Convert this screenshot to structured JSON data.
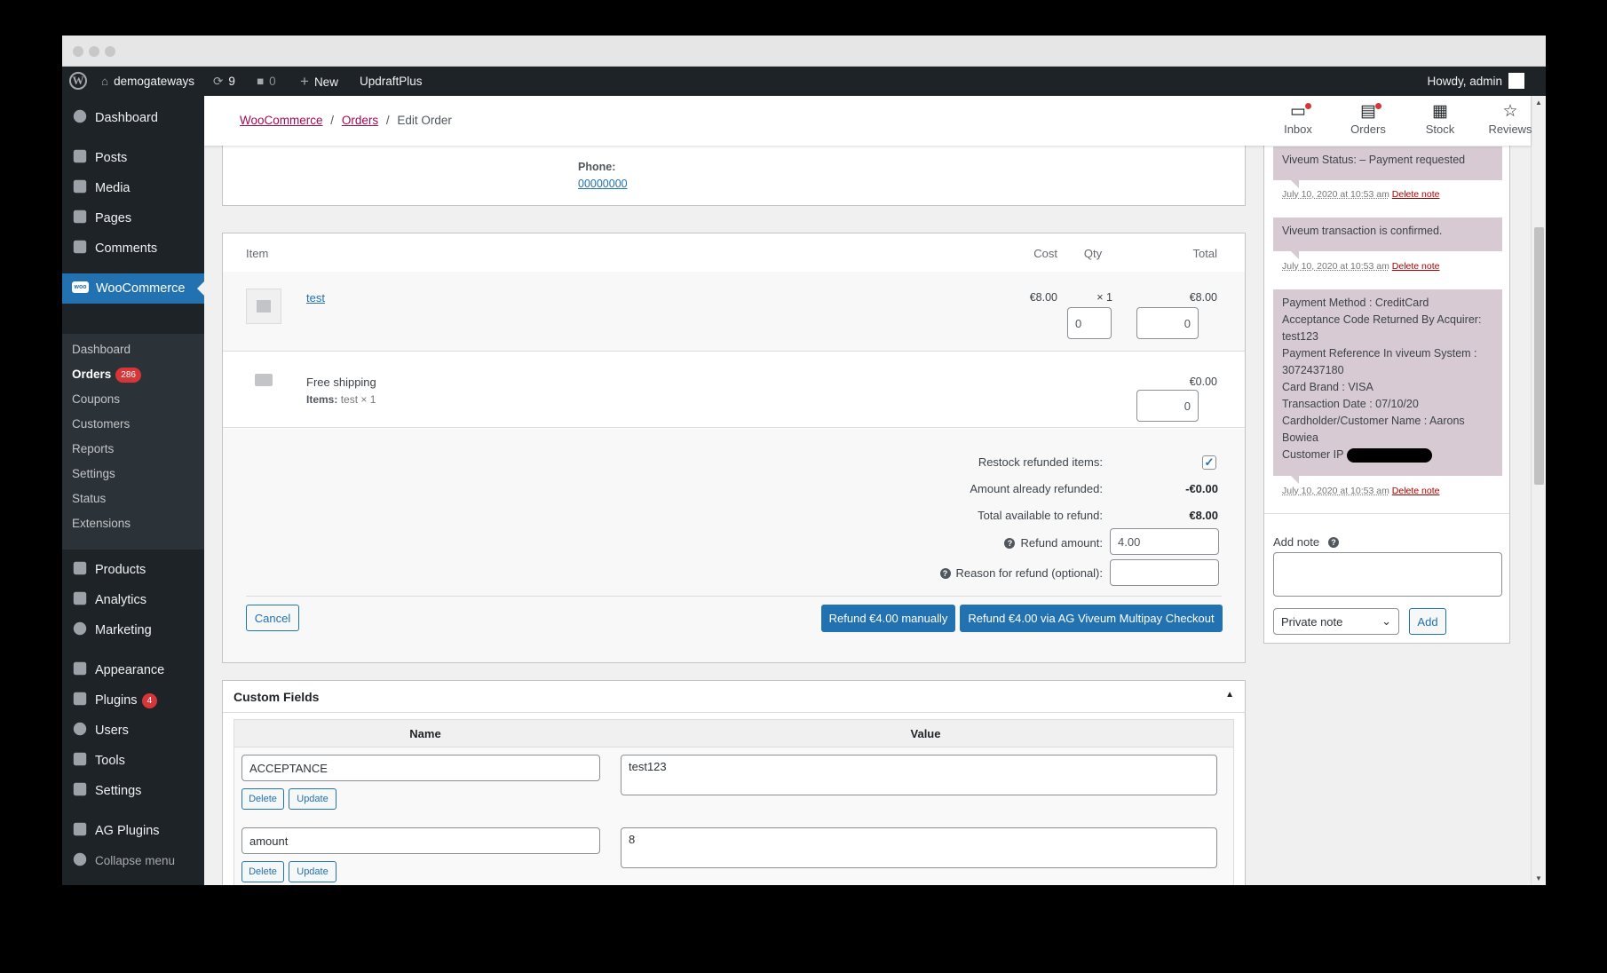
{
  "adminbar": {
    "site_name": "demogateways",
    "updates_count": "9",
    "comments_count": "0",
    "new_label": "New",
    "plugin_label": "UpdraftPlus",
    "howdy": "Howdy, admin"
  },
  "sidebar": {
    "dashboard": "Dashboard",
    "posts": "Posts",
    "media": "Media",
    "pages": "Pages",
    "comments": "Comments",
    "woocommerce": "WooCommerce",
    "sub": {
      "dashboard": "Dashboard",
      "orders": "Orders",
      "orders_badge": "286",
      "coupons": "Coupons",
      "customers": "Customers",
      "reports": "Reports",
      "settings": "Settings",
      "status": "Status",
      "extensions": "Extensions"
    },
    "products": "Products",
    "analytics": "Analytics",
    "marketing": "Marketing",
    "appearance": "Appearance",
    "plugins": "Plugins",
    "plugins_badge": "4",
    "users": "Users",
    "tools": "Tools",
    "settings": "Settings",
    "ag_plugins": "AG Plugins",
    "collapse": "Collapse menu"
  },
  "header": {
    "breadcrumb_1": "WooCommerce",
    "breadcrumb_2": "Orders",
    "breadcrumb_current": "Edit Order",
    "sep": "/",
    "inbox": "Inbox",
    "orders": "Orders",
    "stock": "Stock",
    "reviews": "Reviews"
  },
  "address": {
    "phone_label": "Phone:",
    "phone_value": "00000000"
  },
  "items": {
    "col_item": "Item",
    "col_cost": "Cost",
    "col_qty": "Qty",
    "col_total": "Total",
    "product_name": "test",
    "product_cost": "€8.00",
    "product_qty": "× 1",
    "product_total": "€8.00",
    "refund_qty": "0",
    "refund_total": "0",
    "shipping_name": "Free shipping",
    "shipping_items_label": "Items:",
    "shipping_items_value": "test × 1",
    "shipping_total": "€0.00",
    "shipping_refund": "0"
  },
  "refund": {
    "restock_label": "Restock refunded items:",
    "restock_checked": true,
    "already_label": "Amount already refunded:",
    "already_value": "-€0.00",
    "available_label": "Total available to refund:",
    "available_value": "€8.00",
    "amount_label": "Refund amount:",
    "amount_value": "4.00",
    "reason_label": "Reason for refund (optional):",
    "reason_value": "",
    "cancel": "Cancel",
    "manual_button": "Refund €4.00 manually",
    "gateway_button": "Refund €4.00 via AG Viveum Multipay Checkout"
  },
  "custom_fields": {
    "title": "Custom Fields",
    "col_name": "Name",
    "col_value": "Value",
    "rows": [
      {
        "name": "ACCEPTANCE",
        "value": "test123"
      },
      {
        "name": "amount",
        "value": "8"
      }
    ],
    "delete_label": "Delete",
    "update_label": "Update"
  },
  "notes": {
    "items": [
      {
        "text": "Viveum Status: – Payment requested",
        "date": "July 10, 2020 at 10:53 am",
        "delete": "Delete note"
      },
      {
        "text": "Viveum transaction is confirmed.",
        "date": "July 10, 2020 at 10:53 am",
        "delete": "Delete note"
      },
      {
        "lines": [
          "Payment Method : CreditCard",
          "Acceptance Code Returned By Acquirer:",
          "test123",
          "Payment Reference In viveum System :",
          "3072437180",
          "Card Brand : VISA",
          "Transaction Date : 07/10/20",
          "Cardholder/Customer Name : Aarons",
          "Bowiea",
          "Customer IP"
        ],
        "date": "July 10, 2020 at 10:53 am",
        "delete": "Delete note"
      }
    ],
    "add_note_label": "Add note",
    "note_type": "Private note",
    "add_button": "Add"
  },
  "colors": {
    "admin_dark": "#1d2327",
    "primary": "#2271b1",
    "note_bg": "#d7cad2",
    "badge": "#d63638"
  }
}
